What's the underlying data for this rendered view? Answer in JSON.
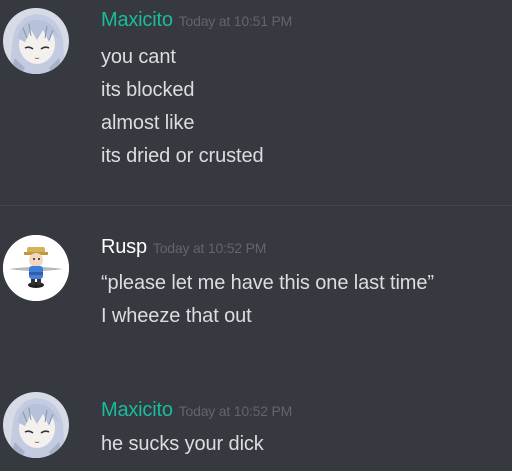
{
  "colors": {
    "background": "#36393f",
    "text": "#dcddde",
    "timestamp": "#62656b",
    "maxicito_name": "#1abc9c",
    "rusp_name": "#ffffff"
  },
  "messages": [
    {
      "username": "Maxicito",
      "timestamp": "Today at 10:51 PM",
      "avatar": "anime-girl-avatar",
      "lines": [
        "you cant",
        "its blocked",
        "almost like",
        "its dried or crusted"
      ]
    },
    {
      "username": "Rusp",
      "timestamp": "Today at 10:52 PM",
      "avatar": "cartoon-character-avatar",
      "lines": [
        "“please let me have this one last time”",
        "I wheeze that out"
      ]
    },
    {
      "username": "Maxicito",
      "timestamp": "Today at 10:52 PM",
      "avatar": "anime-girl-avatar",
      "lines": [
        "he sucks your dick"
      ]
    }
  ]
}
